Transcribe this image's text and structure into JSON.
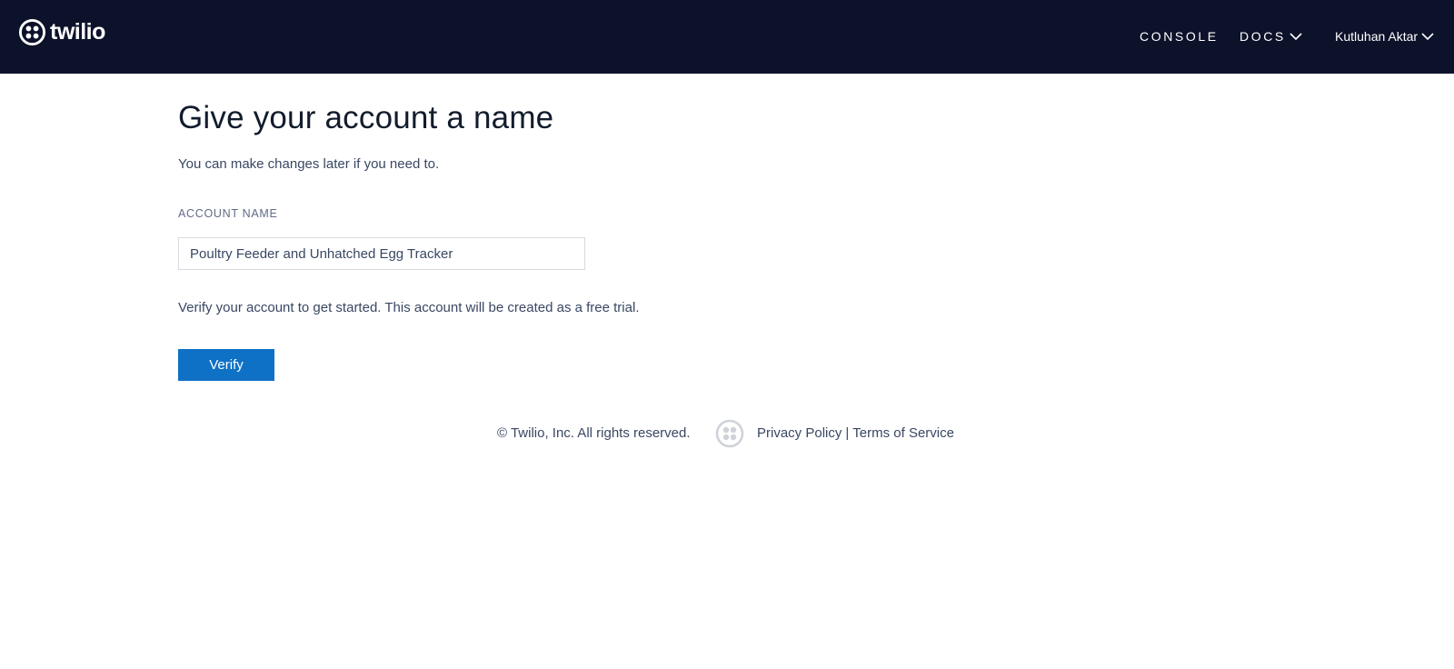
{
  "header": {
    "logo_text": "twilio",
    "nav": {
      "console": "CONSOLE",
      "docs": "DOCS",
      "user": "Kutluhan Aktar"
    }
  },
  "main": {
    "title": "Give your account a name",
    "subtitle": "You can make changes later if you need to.",
    "account_name_label": "ACCOUNT NAME",
    "account_name_value": "Poultry Feeder and Unhatched Egg Tracker",
    "notice": "Verify your account to get started. This account will be created as a free trial.",
    "verify_label": "Verify"
  },
  "footer": {
    "copyright": "© Twilio, Inc. All rights reserved.",
    "privacy": "Privacy Policy",
    "separator": "|",
    "terms": "Terms of Service"
  },
  "icons": {
    "logo": "twilio-logo-icon",
    "chevron": "chevron-down-icon",
    "footer": "twilio-footer-icon"
  },
  "colors": {
    "topbar": "#0d122b",
    "button": "#0f71c6",
    "text": "#394762",
    "heading": "#121c2d"
  }
}
